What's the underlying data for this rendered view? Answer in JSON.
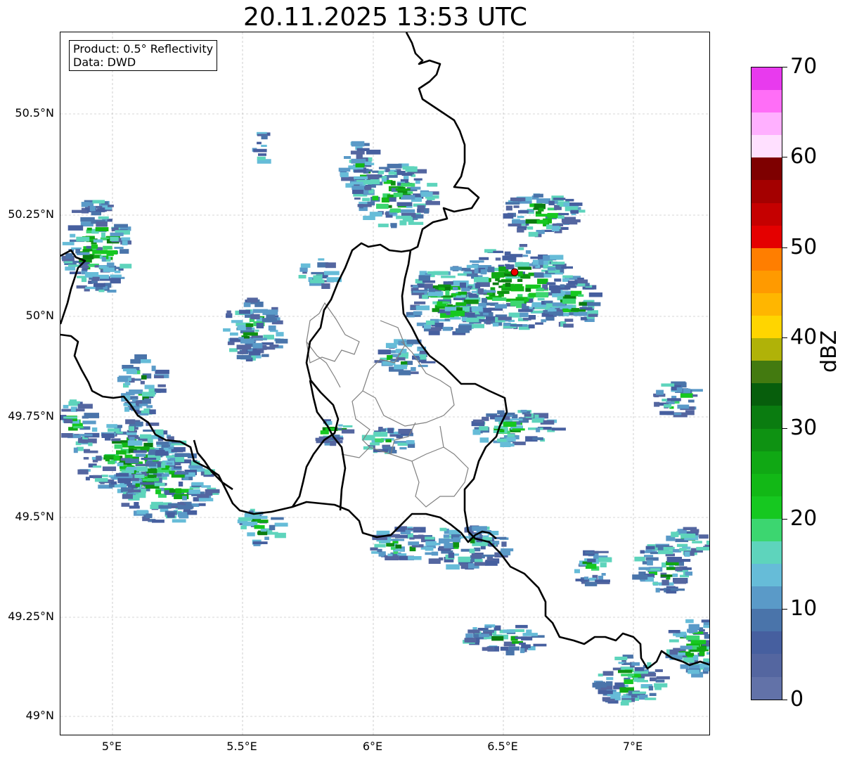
{
  "title": "20.11.2025 13:53 UTC",
  "infobox": {
    "line1": "Product: 0.5° Reflectivity",
    "line2": "Data: DWD"
  },
  "lat_ticks": [
    "50.5°N",
    "50.25°N",
    "50°N",
    "49.75°N",
    "49.5°N",
    "49.25°N",
    "49°N"
  ],
  "lon_ticks": [
    "5°E",
    "5.5°E",
    "6°E",
    "6.5°E",
    "7°E"
  ],
  "colorbar": {
    "label": "dBZ",
    "ticks": [
      "0",
      "10",
      "20",
      "30",
      "40",
      "50",
      "60",
      "70"
    ],
    "colors": [
      "#6272a8",
      "#5466a0",
      "#465f9f",
      "#4a74aa",
      "#5a9ac8",
      "#66bcd8",
      "#5ed4bc",
      "#3cd670",
      "#16c820",
      "#12b816",
      "#10a814",
      "#0e9212",
      "#0a7c10",
      "#075e0c",
      "#437a10",
      "#b0b208",
      "#ffd500",
      "#ffb600",
      "#ff9a00",
      "#ff7e00",
      "#e40000",
      "#c50000",
      "#a40000",
      "#7e0000",
      "#ffe0ff",
      "#ffb0ff",
      "#ff6ef7",
      "#e83aee"
    ]
  },
  "radar_marker_color": "#ee0000"
}
